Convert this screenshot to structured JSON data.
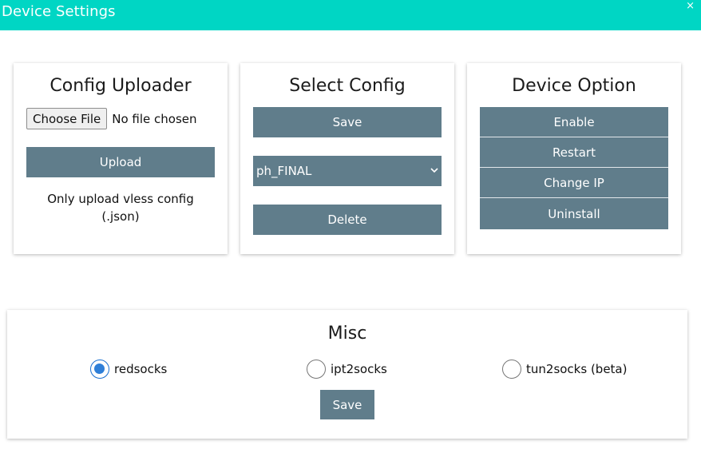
{
  "window": {
    "title": "Device Settings",
    "close_glyph": "×"
  },
  "config_uploader": {
    "title": "Config Uploader",
    "choose_file_label": "Choose File",
    "file_status": "No file chosen",
    "upload_label": "Upload",
    "note_line1": "Only upload vless config",
    "note_line2": "(.json)"
  },
  "select_config": {
    "title": "Select Config",
    "save_label": "Save",
    "selected_value": "ph_FINAL",
    "delete_label": "Delete"
  },
  "device_option": {
    "title": "Device Option",
    "buttons": [
      "Enable",
      "Restart",
      "Change IP",
      "Uninstall"
    ]
  },
  "misc": {
    "title": "Misc",
    "options": [
      {
        "label": "redsocks",
        "checked": true
      },
      {
        "label": "ipt2socks",
        "checked": false
      },
      {
        "label": "tun2socks (beta)",
        "checked": false
      }
    ],
    "save_label": "Save"
  },
  "colors": {
    "titlebar": "#00d6c4",
    "button": "#607d8b",
    "radio_accent": "#2f7fd8"
  },
  "icons": [
    "close-icon",
    "chevron-down-icon",
    "radio-checked-icon",
    "radio-unchecked-icon"
  ]
}
